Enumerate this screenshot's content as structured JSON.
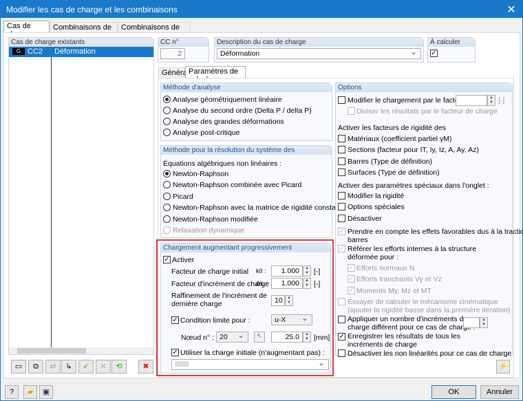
{
  "window": {
    "title": "Modifier les cas de charge et les combinaisons",
    "close": "✕"
  },
  "tabs": [
    "Cas de charge",
    "Combinaisons de charge",
    "Combinaisons de résultats"
  ],
  "list": {
    "header": "Cas de charge existants",
    "rows": [
      {
        "type": "G",
        "id": "CC2",
        "desc": "Déformation"
      }
    ]
  },
  "cc": {
    "label": "CC n°",
    "value": "2"
  },
  "description": {
    "label": "Description du cas de charge",
    "value": "Déformation"
  },
  "calc": {
    "label": "À calculer",
    "checked": true
  },
  "inner_tabs": [
    "Général",
    "Paramètres de calcul"
  ],
  "analysis": {
    "title": "Méthode d'analyse",
    "options": [
      "Analyse géométriquement linéaire",
      "Analyse du second ordre (Delta P / delta P)",
      "Analyse des grandes déformations",
      "Analyse post-critique"
    ],
    "selected": 0
  },
  "solver": {
    "title": "Méthode pour la résolution du système des",
    "subtitle": "Équations algébriques non linéaires :",
    "options": [
      "Newton-Raphson",
      "Newton-Raphson combinée avec Picard",
      "Picard",
      "Newton-Raphson avec la matrice de rigidité constante",
      "Newton-Raphson modifiée",
      "Relaxation dynamique"
    ],
    "selected": 0
  },
  "progressive": {
    "title": "Chargement augmentant progressivement",
    "activate": "Activer",
    "initial_label": "Facteur de charge initial",
    "initial_sym": "k0 :",
    "initial_value": "1.000",
    "unit": "[-]",
    "incr_label": "Facteur d'incrément de charge",
    "incr_sym": "Δk :",
    "incr_value": "1.000",
    "refine_label1": "Raffinement de l'incrément de",
    "refine_label2": "dernière charge",
    "refine_value": "10",
    "limit_label": "Condition limite pour :",
    "limit_value": "u-X",
    "node_label": "Nœud n° :",
    "node_value": "20",
    "limit_amount": "25.0",
    "limit_unit": "[mm]",
    "use_initial": "Utiliser la charge initiale (n'augmentant pas) :"
  },
  "options": {
    "title": "Options",
    "modify": "Modifier le chargement par le facteur :",
    "modify_unit": "[-]",
    "divide": "Diviser les résultats par le facteur de charge",
    "stiff_title": "Activer les facteurs de rigidité des",
    "stiff": [
      "Matériaux (coefficient partiel γM)",
      "Sections (facteur pour IT, Iy, Iz, A, Ay, Az)",
      "Barres (Type de définition)",
      "Surfaces (Type de définition)"
    ],
    "special_title": "Activer des paramètres spéciaux dans l'onglet :",
    "special": [
      "Modifier la rigidité",
      "Options spéciales",
      "Désactiver"
    ],
    "favorable1": "Prendre en compte les effets favorables dus à la traction des",
    "favorable2": "barres",
    "refer1": "Référer les efforts internes à la structure",
    "refer2": "déformée pour :",
    "refer_items": [
      "Efforts normaux N",
      "Efforts tranchants Vy et Vz",
      "Moments My, Mz et MT"
    ],
    "kin1": "Essayer de calculer le mécanisme cinématique",
    "kin2": "(ajouter la rigidité basse dans la première itération)",
    "apply1": "Appliquer un nombre d'incréments de",
    "apply2": "charge différent pour ce cas de charge :",
    "save1": "Enregistrer les résultats de tous les",
    "save2": "incréments de charge",
    "deact": "Désactiver les non linéarités pour ce cas de charge"
  },
  "buttons": {
    "ok": "OK",
    "cancel": "Annuler"
  },
  "colors": {
    "accent": "#1979ca",
    "highlight": "#e0393e"
  }
}
